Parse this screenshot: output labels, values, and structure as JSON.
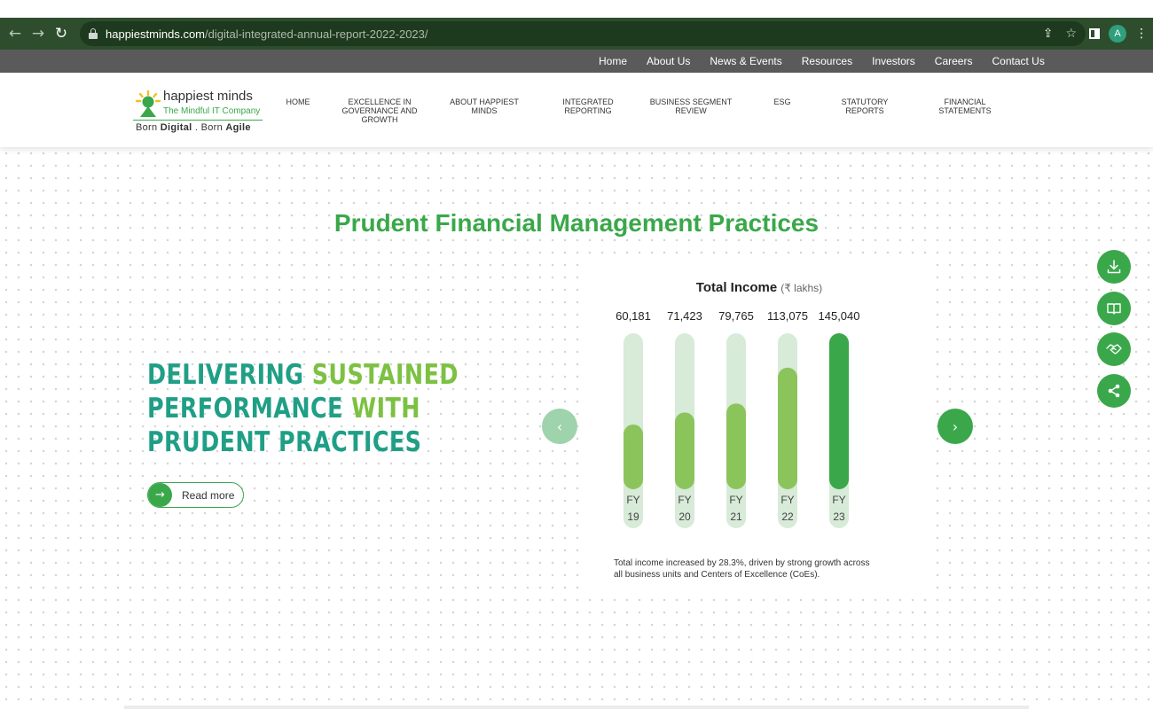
{
  "browser": {
    "url_host": "happiestminds.com",
    "url_path": "/digital-integrated-annual-report-2022-2023/",
    "profile_initial": "A",
    "icons": [
      "back-icon",
      "forward-icon",
      "reload-icon",
      "lock-icon",
      "share-icon",
      "star-icon",
      "side-panel-icon",
      "menu-icon"
    ]
  },
  "top_nav": {
    "items": [
      "Home",
      "About Us",
      "News & Events",
      "Resources",
      "Investors",
      "Careers",
      "Contact Us"
    ]
  },
  "logo": {
    "name": "happiest minds",
    "tagline": "The Mindful IT Company",
    "born_prefix": "Born ",
    "born_digital": "Digital",
    "born_middle": " . Born ",
    "born_agile": "Agile"
  },
  "main_nav": {
    "items": [
      {
        "line1": "HOME",
        "line2": "",
        "line3": ""
      },
      {
        "line1": "EXCELLENCE IN",
        "line2": "GOVERNANCE AND",
        "line3": "GROWTH"
      },
      {
        "line1": "ABOUT HAPPIEST",
        "line2": "MINDS",
        "line3": ""
      },
      {
        "line1": "INTEGRATED",
        "line2": "REPORTING",
        "line3": ""
      },
      {
        "line1": "BUSINESS SEGMENT",
        "line2": "REVIEW",
        "line3": ""
      },
      {
        "line1": "ESG",
        "line2": "",
        "line3": ""
      },
      {
        "line1": "STATUTORY",
        "line2": "REPORTS",
        "line3": ""
      },
      {
        "line1": "FINANCIAL",
        "line2": "STATEMENTS",
        "line3": ""
      }
    ]
  },
  "hero": {
    "section_title": "Prudent Financial Management Practices",
    "headline_1a": "DELIVERING ",
    "headline_1b": "SUSTAINED",
    "headline_2a": "PERFORMANCE ",
    "headline_2b": "WITH",
    "headline_3": "PRUDENT PRACTICES",
    "read_more": "Read more",
    "caption": "Total income increased by 28.3%, driven by strong growth across all business units and Centers of Excellence (CoEs)."
  },
  "colors": {
    "brand_green": "#3aa84a",
    "light_green": "#8cc45c",
    "teal": "#1f9f86",
    "lime": "#7cc141",
    "track": "#d7ebd8"
  },
  "chart_data": {
    "type": "bar",
    "title": "Total Income",
    "unit": "(₹ lakhs)",
    "categories": [
      [
        "FY",
        "19"
      ],
      [
        "FY",
        "20"
      ],
      [
        "FY",
        "21"
      ],
      [
        "FY",
        "22"
      ],
      [
        "FY",
        "23"
      ]
    ],
    "value_labels": [
      "60,181",
      "71,423",
      "79,765",
      "113,075",
      "145,040"
    ],
    "values": [
      60181,
      71423,
      79765,
      113075,
      145040
    ],
    "ylim": [
      0,
      145040
    ],
    "highlight_index": 4
  },
  "floating_actions": [
    "download-icon",
    "book-icon",
    "handshake-icon",
    "share-icon"
  ]
}
